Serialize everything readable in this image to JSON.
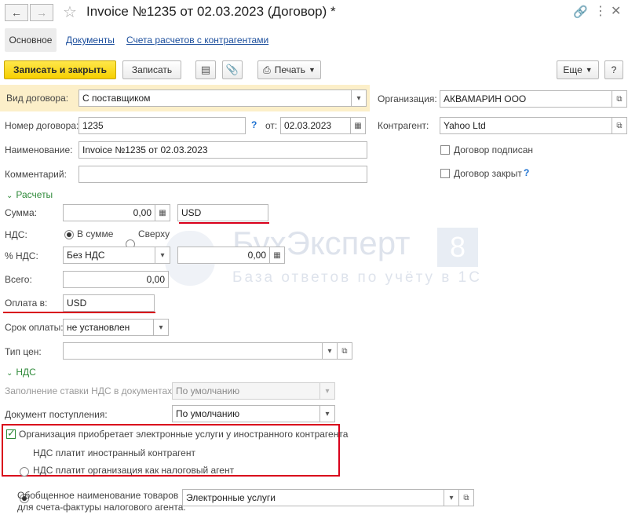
{
  "window": {
    "title": "Invoice №1235 от 02.03.2023 (Договор) *",
    "back_icon": "arrow-left-icon",
    "forward_icon": "arrow-right-icon",
    "star_icon": "star-icon"
  },
  "tabs": [
    {
      "label": "Основное",
      "active": true
    },
    {
      "label": "Документы"
    },
    {
      "label": "Счета расчетов с контрагентами"
    }
  ],
  "toolbar": {
    "save_close": "Записать и закрыть",
    "save": "Записать",
    "print": "Печать",
    "more": "Еще",
    "help": "?"
  },
  "form": {
    "contract_type_label": "Вид договора:",
    "contract_type_value": "С поставщиком",
    "number_label": "Номер договора:",
    "number_value": "1235",
    "date_label": "от:",
    "date_value": "02.03.2023",
    "name_label": "Наименование:",
    "name_value": "Invoice №1235 от 02.03.2023",
    "comment_label": "Комментарий:",
    "comment_value": "",
    "org_label": "Организация:",
    "org_value": "АКВАМАРИН ООО",
    "counterparty_label": "Контрагент:",
    "counterparty_value": "Yahoo Ltd",
    "signed_label": "Договор подписан",
    "closed_label": "Договор закрыт",
    "help_mark": "?"
  },
  "settlements": {
    "header": "Расчеты",
    "sum_label": "Сумма:",
    "sum_value": "0,00",
    "currency_value": "USD",
    "vat_label": "НДС:",
    "vat_in_sum": "В сумме",
    "vat_on_top": "Сверху",
    "vat_rate_label": "% НДС:",
    "vat_rate_value": "Без НДС",
    "vat_amount_value": "0,00",
    "total_label": "Всего:",
    "total_value": "0,00",
    "payment_in_label": "Оплата в:",
    "payment_in_value": "USD",
    "due_label": "Срок оплаты:",
    "due_value": "не установлен",
    "price_type_label": "Тип цен:",
    "price_type_value": ""
  },
  "vat": {
    "header": "НДС",
    "fill_rate_label": "Заполнение ставки НДС в документах:",
    "fill_rate_value": "По умолчанию",
    "receipt_doc_label": "Документ поступления:",
    "receipt_doc_value": "По умолчанию",
    "electronic_services_label": "Организация приобретает электронные услуги у иностранного контрагента",
    "foreign_pays_label": "НДС платит иностранный контрагент",
    "org_agent_pays_label": "НДС платит организация как налоговый агент",
    "generic_name_label_line1": "Обобщенное наименование товаров",
    "generic_name_label_line2": "для счета-фактуры налогового агента:",
    "generic_name_value": "Электронные услуги"
  },
  "watermark": {
    "brand": "БухЭксперт",
    "brand_number": "8",
    "tagline": "База ответов по учёту в 1С"
  },
  "colors": {
    "accent_yellow": "#f6cf00",
    "section_green": "#2f8a3a",
    "highlight_red": "#d9001b",
    "link_blue": "#1a4d9c"
  }
}
